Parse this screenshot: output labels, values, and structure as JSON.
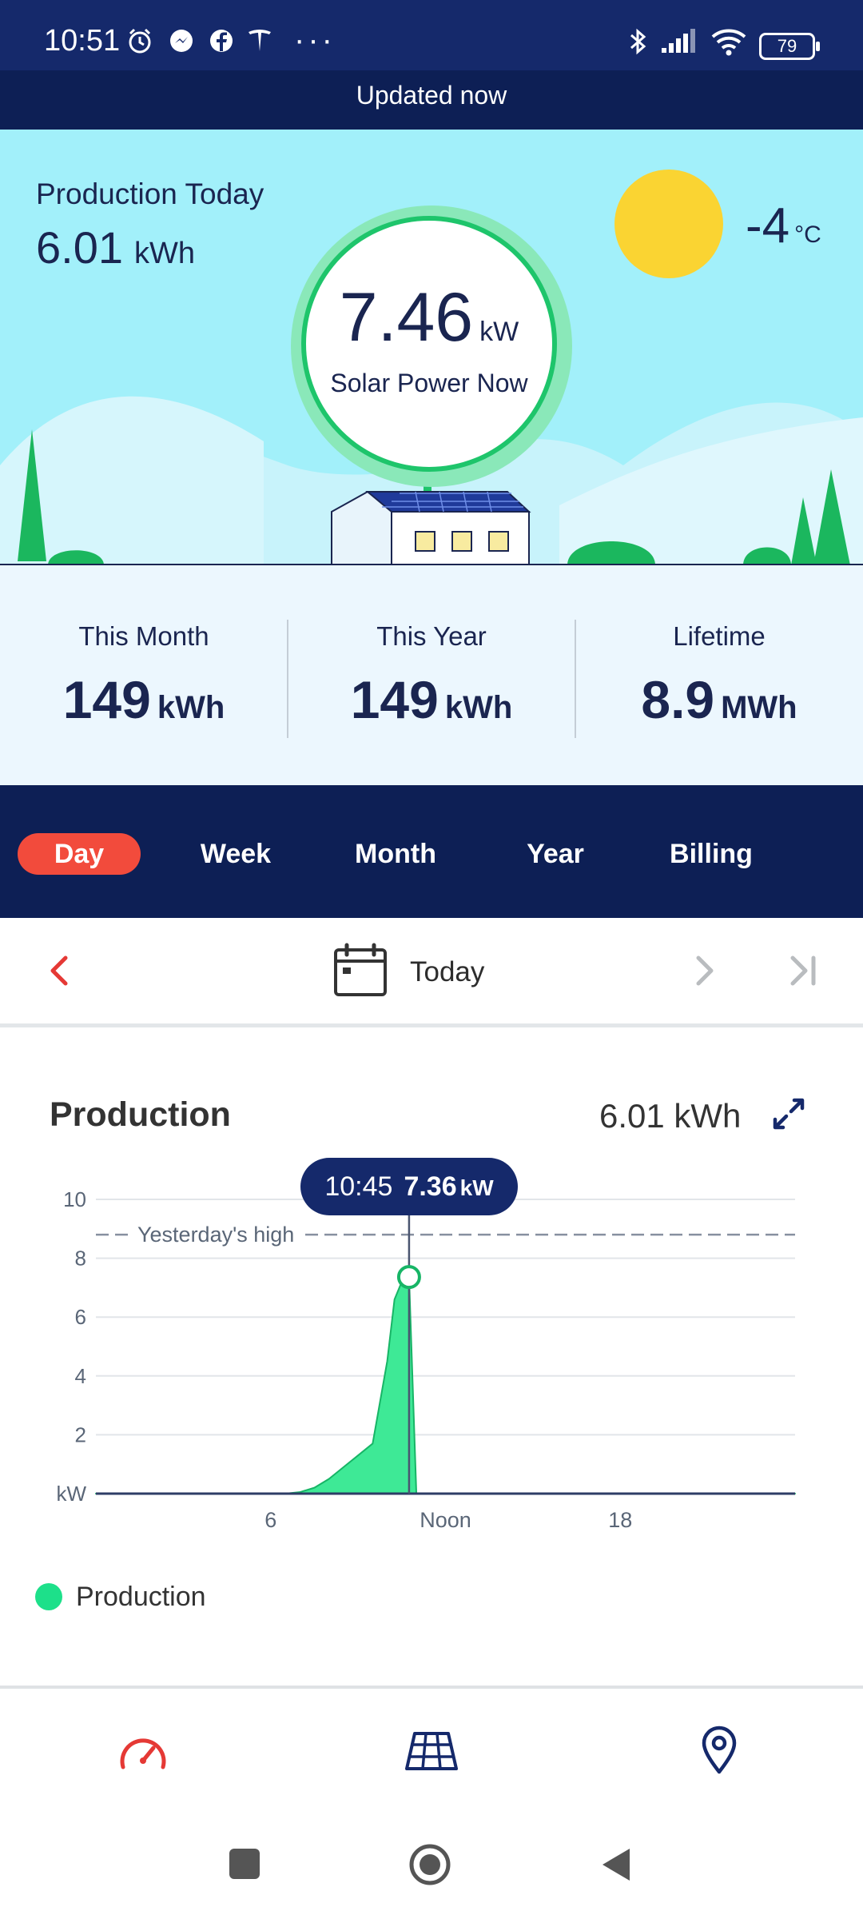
{
  "status_bar": {
    "time": "10:51",
    "more": "···",
    "battery": "79"
  },
  "updated_banner": "Updated now",
  "hero": {
    "production_today_label": "Production Today",
    "production_today_value": "6.01",
    "production_today_unit": "kWh",
    "temperature": "-4",
    "temperature_unit": "°C",
    "solar_power_value": "7.46",
    "solar_power_unit": "kW",
    "solar_power_label": "Solar Power Now"
  },
  "stats": [
    {
      "label": "This Month",
      "value": "149",
      "unit": "kWh"
    },
    {
      "label": "This Year",
      "value": "149",
      "unit": "kWh"
    },
    {
      "label": "Lifetime",
      "value": "8.9",
      "unit": "MWh"
    }
  ],
  "tabs": [
    "Day",
    "Week",
    "Month",
    "Year",
    "Billing"
  ],
  "active_tab": "Day",
  "date_nav": {
    "label": "Today"
  },
  "production": {
    "title": "Production",
    "total": "6.01 kWh",
    "tooltip_time": "10:45",
    "tooltip_value": "7.36",
    "tooltip_unit": "kW",
    "legend_label": "Production"
  },
  "chart_data": {
    "type": "area",
    "x": [
      0,
      6.5,
      7,
      7.5,
      8,
      8.5,
      9,
      9.5,
      10,
      10.25,
      10.5,
      10.75,
      11,
      12,
      18,
      24
    ],
    "series": [
      {
        "name": "Production",
        "values": [
          0,
          0,
          0.05,
          0.2,
          0.5,
          0.9,
          1.3,
          1.7,
          4.5,
          6.6,
          7.2,
          7.36,
          0,
          0,
          0,
          0
        ]
      }
    ],
    "reference_line": {
      "label": "Yesterday's high",
      "value": 8.8
    },
    "xticks": [
      {
        "value": 6,
        "label": "6"
      },
      {
        "value": 12,
        "label": "Noon"
      },
      {
        "value": 18,
        "label": "18"
      }
    ],
    "yticks": [
      {
        "value": 0,
        "label": "kW"
      },
      {
        "value": 2,
        "label": "2"
      },
      {
        "value": 4,
        "label": "4"
      },
      {
        "value": 6,
        "label": "6"
      },
      {
        "value": 8,
        "label": "8"
      },
      {
        "value": 10,
        "label": "10"
      }
    ],
    "ylim": [
      0,
      10
    ],
    "xlim": [
      0,
      24
    ],
    "cursor_x": 10.75,
    "color": "#1de08a"
  },
  "colors": {
    "navy": "#0d1f55",
    "accent": "#f24b3c",
    "sky": "#a2f0fa",
    "green": "#1ec56b"
  }
}
